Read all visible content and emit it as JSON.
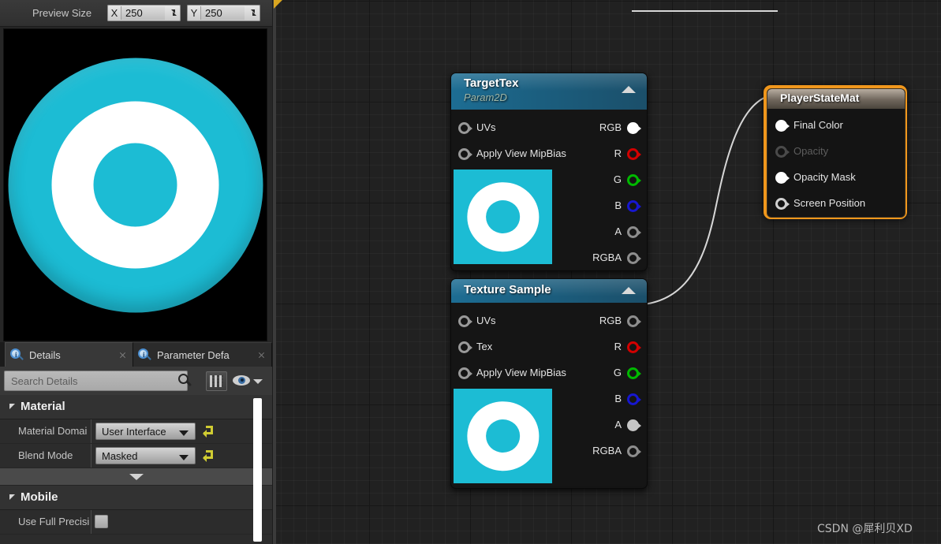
{
  "app": {
    "watermark": "CSDN @犀利贝XD"
  },
  "preview_toolbar": {
    "label": "Preview Size",
    "x_axis": "X",
    "x_value": "250",
    "y_axis": "Y",
    "y_value": "250"
  },
  "preview_viewport": {
    "name": "material-preview",
    "ring_color": "#1cbcd4",
    "mid_color": "#ffffff",
    "background": "#000000"
  },
  "tabs": [
    {
      "label": "Details",
      "active": true,
      "icon": "details-magnifier-icon"
    },
    {
      "label": "Parameter Defa",
      "active": false,
      "icon": "details-magnifier-icon"
    }
  ],
  "details": {
    "search_placeholder": "Search Details",
    "search_value": "",
    "buttons": {
      "grid_view": "grid-view-icon",
      "eye": "visibility-eye-icon",
      "eye_caret": "chevron-down-icon"
    },
    "categories": [
      {
        "name": "Material",
        "rows": [
          {
            "label": "Material Domai",
            "control": "combo",
            "value": "User Interface",
            "reset": true
          },
          {
            "label": "Blend Mode",
            "control": "combo",
            "value": "Masked",
            "reset": true
          }
        ]
      },
      {
        "name": "Mobile",
        "rows": [
          {
            "label": "Use Full Precisi",
            "control": "checkbox",
            "value": "",
            "reset": false
          }
        ]
      }
    ]
  },
  "graph": {
    "nodes": [
      {
        "id": "targettex",
        "title": "TargetTex",
        "subtitle": "Param2D",
        "collapse": "collapse-arrow-icon",
        "inputs": [
          {
            "label": "UVs",
            "state": "empty"
          },
          {
            "label": "Apply View MipBias",
            "state": "empty"
          }
        ],
        "outputs": [
          {
            "label": "RGB",
            "state": "filled",
            "color": "#ffffff"
          },
          {
            "label": "R",
            "state": "empty",
            "color": "#d20000"
          },
          {
            "label": "G",
            "state": "empty",
            "color": "#00b800"
          },
          {
            "label": "B",
            "state": "empty",
            "color": "#1717cf"
          },
          {
            "label": "A",
            "state": "empty",
            "color": "#8d8d8d"
          },
          {
            "label": "RGBA",
            "state": "empty",
            "color": "#8d8d8d"
          }
        ],
        "thumbnail": "texture-thumbnail-target"
      },
      {
        "id": "texturesample",
        "title": "Texture Sample",
        "subtitle": "",
        "collapse": "collapse-arrow-icon",
        "inputs": [
          {
            "label": "UVs",
            "state": "empty"
          },
          {
            "label": "Tex",
            "state": "empty"
          },
          {
            "label": "Apply View MipBias",
            "state": "empty"
          }
        ],
        "outputs": [
          {
            "label": "RGB",
            "state": "empty",
            "color": "#8d8d8d"
          },
          {
            "label": "R",
            "state": "empty",
            "color": "#d20000"
          },
          {
            "label": "G",
            "state": "empty",
            "color": "#00b800"
          },
          {
            "label": "B",
            "state": "empty",
            "color": "#1717cf"
          },
          {
            "label": "A",
            "state": "filled",
            "color": "#c6c6c6"
          },
          {
            "label": "RGBA",
            "state": "empty",
            "color": "#8d8d8d"
          }
        ],
        "thumbnail": "texture-thumbnail-sample"
      }
    ],
    "result_node": {
      "title": "PlayerStateMat",
      "selected_outline": "#f0971c",
      "inputs": [
        {
          "label": "Final Color",
          "state": "filled"
        },
        {
          "label": "Opacity",
          "state": "disabled"
        },
        {
          "label": "Opacity Mask",
          "state": "filled"
        },
        {
          "label": "Screen Position",
          "state": "empty"
        }
      ]
    }
  }
}
